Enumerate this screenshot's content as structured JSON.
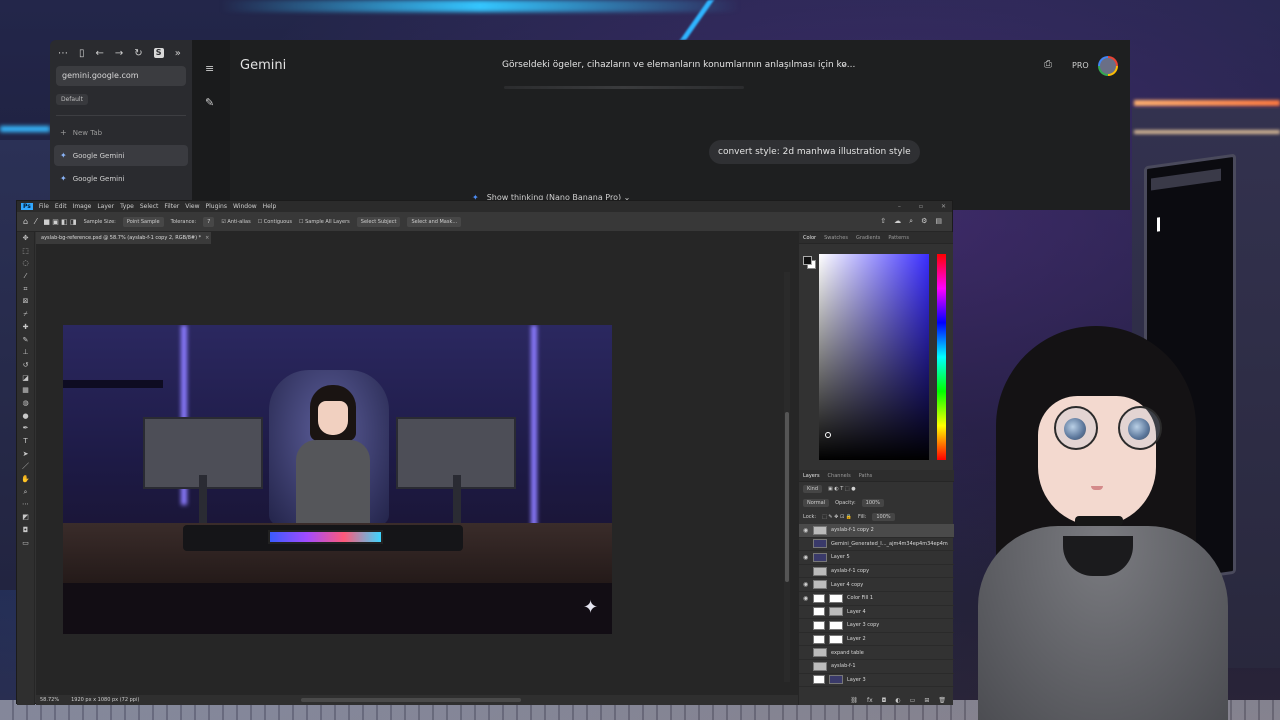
{
  "browser": {
    "url": "gemini.google.com",
    "profile": "Default",
    "tabs": [
      {
        "label": "New Tab"
      },
      {
        "label": "Google Gemini"
      },
      {
        "label": "Google Gemini"
      }
    ]
  },
  "gemini": {
    "app_title": "Gemini",
    "chat_title": "Görseldeki ögeler, cihazların ve elemanların konumlarının anlaşılması için ko...",
    "badge": "PRO",
    "user_message": "convert style: 2d manhwa illustration style",
    "thinking_label": "Show thinking (Nano Banana Pro)",
    "icons": [
      "menu-icon",
      "new-chat-icon",
      "print-icon",
      "chevron-down-icon",
      "sparkle-icon"
    ]
  },
  "photoshop": {
    "menu": [
      "File",
      "Edit",
      "Image",
      "Layer",
      "Type",
      "Select",
      "Filter",
      "View",
      "Plugins",
      "Window",
      "Help"
    ],
    "options": {
      "sample_size_label": "Sample Size:",
      "sample_size_value": "Point Sample",
      "tolerance_label": "Tolerance:",
      "tolerance_value": "7",
      "anti_alias": "Anti-alias",
      "contiguous": "Contiguous",
      "sample_all_layers": "Sample All Layers",
      "select_subject": "Select Subject",
      "select_and_mask": "Select and Mask..."
    },
    "doc_tab": "ayslab-bg-reference.psd @ 58.7% (ayslab-f-1 copy 2, RGB/8#) *",
    "status": {
      "zoom": "58.72%",
      "doc_info": "1920 px x 1080 px (72 ppi)"
    },
    "color_panel_tabs": [
      "Color",
      "Swatches",
      "Gradients",
      "Patterns"
    ],
    "layers_panel_tabs": [
      "Layers",
      "Channels",
      "Paths"
    ],
    "layer_options": {
      "kind": "Kind",
      "blend_mode": "Normal",
      "opacity_label": "Opacity:",
      "opacity_value": "100%",
      "lock_label": "Lock:",
      "fill_label": "Fill:",
      "fill_value": "100%"
    },
    "layers": [
      {
        "name": "ayslab-f-1 copy 2",
        "visible": true,
        "selected": true
      },
      {
        "name": "Gemini_Generated_I..._ajm4m34ep4m34ep4m",
        "visible": false
      },
      {
        "name": "Layer 5",
        "visible": true
      },
      {
        "name": "ayslab-f-1 copy",
        "visible": false
      },
      {
        "name": "Layer 4 copy",
        "visible": true
      },
      {
        "name": "Color Fill 1",
        "visible": true
      },
      {
        "name": "Layer 4",
        "visible": false
      },
      {
        "name": "Layer 3 copy",
        "visible": false
      },
      {
        "name": "Layer 2",
        "visible": false
      },
      {
        "name": "expand table",
        "visible": false
      },
      {
        "name": "ayslab-f-1",
        "visible": false
      },
      {
        "name": "Layer 3",
        "visible": false
      }
    ]
  },
  "colors": {
    "neon_blue": "#34c6ff",
    "photoshop_bg": "#323232",
    "gemini_bg": "#1e1f20"
  }
}
